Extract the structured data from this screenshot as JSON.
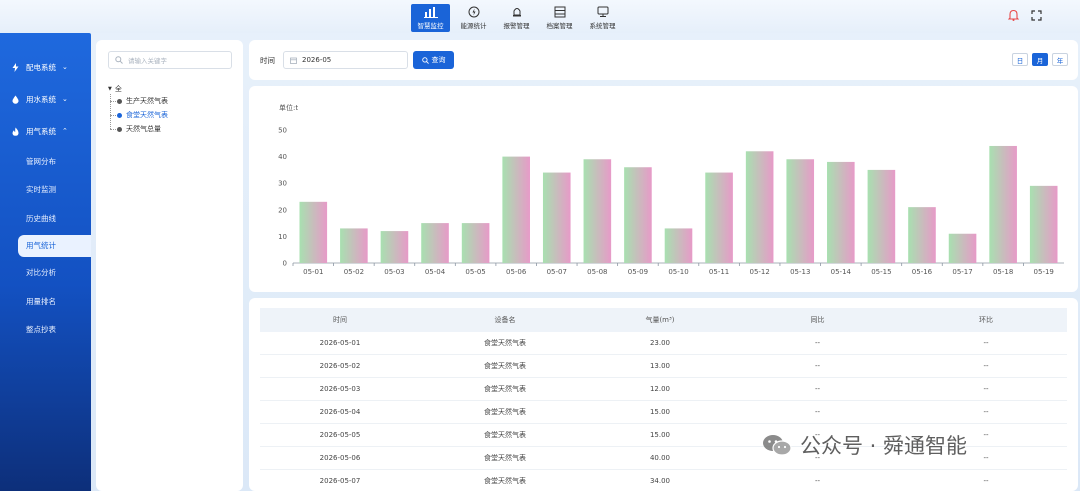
{
  "topnav": {
    "items": [
      {
        "label": "智慧监控",
        "icon": "bar-chart-icon",
        "active": true
      },
      {
        "label": "能源统计",
        "icon": "energy-icon",
        "active": false
      },
      {
        "label": "报警管理",
        "icon": "alarm-icon",
        "active": false
      },
      {
        "label": "档案管理",
        "icon": "archive-icon",
        "active": false
      },
      {
        "label": "系统管理",
        "icon": "monitor-icon",
        "active": false
      }
    ]
  },
  "sidebar": {
    "groups": [
      {
        "label": "配电系统",
        "icon": "lightning-icon"
      },
      {
        "label": "用水系统",
        "icon": "water-drop-icon"
      },
      {
        "label": "用气系统",
        "icon": "flame-icon"
      }
    ],
    "items": [
      {
        "label": "管网分布"
      },
      {
        "label": "实时监测"
      },
      {
        "label": "历史曲线"
      },
      {
        "label": "用气统计",
        "active": true
      },
      {
        "label": "对比分析"
      },
      {
        "label": "用量排名"
      },
      {
        "label": "整点抄表"
      }
    ]
  },
  "tree": {
    "search_placeholder": "请输入关键字",
    "root": "全",
    "nodes": [
      "生产天然气表",
      "食堂天然气表",
      "天然气总量"
    ],
    "selected": "食堂天然气表"
  },
  "query": {
    "time_label": "时间",
    "date_value": "2026-05",
    "button_label": "查询",
    "view_buttons": [
      "日",
      "月",
      "年"
    ],
    "view_active": "月"
  },
  "chart_data": {
    "type": "bar",
    "ylabel": "单位:t",
    "categories": [
      "05-01",
      "05-02",
      "05-03",
      "05-04",
      "05-05",
      "05-06",
      "05-07",
      "05-08",
      "05-09",
      "05-10",
      "05-11",
      "05-12",
      "05-13",
      "05-14",
      "05-15",
      "05-16",
      "05-17",
      "05-18",
      "05-19"
    ],
    "values": [
      23,
      13,
      12,
      15,
      15,
      40,
      34,
      39,
      36,
      13,
      34,
      42,
      39,
      38,
      35,
      21,
      11,
      44,
      29
    ],
    "ylim": [
      0,
      50
    ],
    "yticks": [
      0,
      10,
      20,
      30,
      40,
      50
    ],
    "grid": false,
    "colors": {
      "bar_top": "#e79ac8",
      "bar_bottom": "#a8e0b0"
    }
  },
  "table": {
    "columns": [
      "时间",
      "设备名",
      "气量(m³)",
      "同比",
      "环比"
    ],
    "rows": [
      [
        "2026-05-01",
        "食堂天然气表",
        "23.00",
        "--",
        "--"
      ],
      [
        "2026-05-02",
        "食堂天然气表",
        "13.00",
        "--",
        "--"
      ],
      [
        "2026-05-03",
        "食堂天然气表",
        "12.00",
        "--",
        "--"
      ],
      [
        "2026-05-04",
        "食堂天然气表",
        "15.00",
        "--",
        "--"
      ],
      [
        "2026-05-05",
        "食堂天然气表",
        "15.00",
        "--",
        "--"
      ],
      [
        "2026-05-06",
        "食堂天然气表",
        "40.00",
        "--",
        "--"
      ],
      [
        "2026-05-07",
        "食堂天然气表",
        "34.00",
        "--",
        "--"
      ]
    ]
  },
  "watermark": {
    "text": "公众号 · 舜通智能"
  }
}
